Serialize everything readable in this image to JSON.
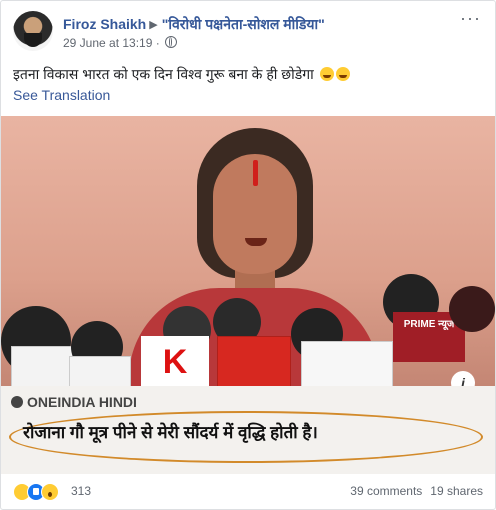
{
  "post": {
    "author": "Firoz Shaikh",
    "group": "\"विरोधी पक्षनेता-सोशल मीडिया\"",
    "timestamp": "29 June at 13:19 ·",
    "caption": "इतना विकास भारत को एक दिन विश्व गुरू बना के ही छोडेगा",
    "see_translation": "See Translation",
    "more_icon": "···"
  },
  "image": {
    "mic_labels": [
      "K",
      "PRIME न्यूज"
    ],
    "source": "ONEINDIA HINDI",
    "quote": "रोजाना गौ मूत्र पीने से मेरी सौंदर्य में वृद्धि होती है।",
    "info_icon": "i"
  },
  "footer": {
    "reaction_count": "313",
    "comments": "39 comments",
    "shares": "19 shares"
  }
}
